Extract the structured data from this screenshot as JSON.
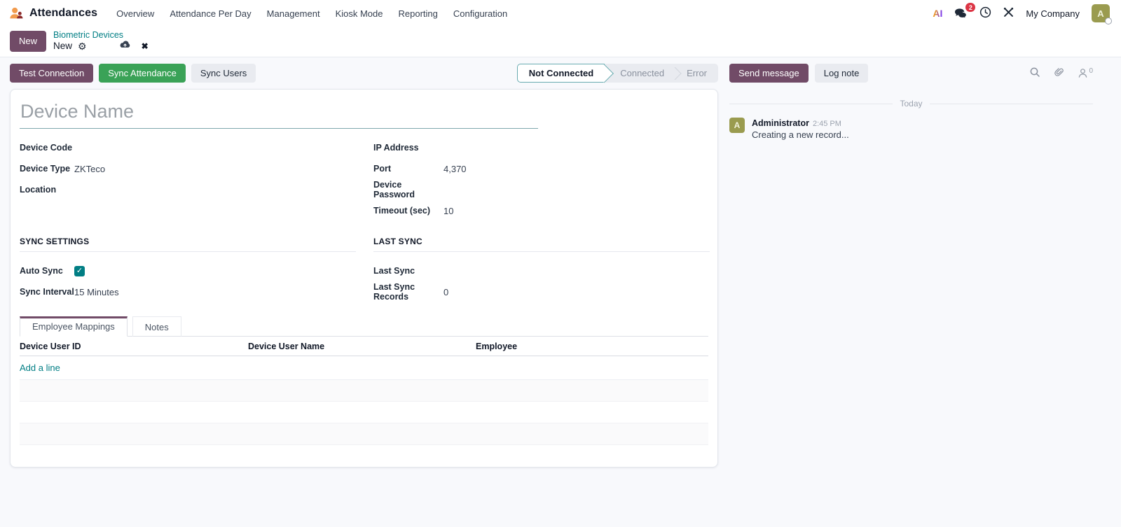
{
  "colors": {
    "primary": "#714B67",
    "accent_teal": "#017E84",
    "success_green": "#3AA257",
    "badge_red": "#DC3545",
    "avatar_olive": "#9A9B4F"
  },
  "icons": {
    "gear": "⚙",
    "discard": "✖",
    "check": "✓"
  },
  "navbar": {
    "app_name": "Attendances",
    "menus": [
      "Overview",
      "Attendance Per Day",
      "Management",
      "Kiosk Mode",
      "Reporting",
      "Configuration"
    ],
    "ai_label": "AI",
    "messages_badge": "2",
    "company": "My Company",
    "avatar_letter": "A"
  },
  "breadcrumb": {
    "new_button": "New",
    "parent": "Biometric Devices",
    "current": "New"
  },
  "actions": {
    "test_connection": "Test Connection",
    "sync_attendance": "Sync Attendance",
    "sync_users": "Sync Users"
  },
  "statusbar": {
    "steps": [
      {
        "label": "Not Connected",
        "active": true
      },
      {
        "label": "Connected",
        "active": false
      },
      {
        "label": "Error",
        "active": false
      }
    ]
  },
  "chatter": {
    "send_message": "Send message",
    "log_note": "Log note",
    "followers_count": "0",
    "date_divider": "Today",
    "messages": [
      {
        "author": "Administrator",
        "time": "2:45 PM",
        "body": "Creating a new record...",
        "avatar_letter": "A"
      }
    ]
  },
  "form": {
    "name_placeholder": "Device Name",
    "fields_left": [
      {
        "label": "Device Code",
        "value": ""
      },
      {
        "label": "Device Type",
        "value": "ZKTeco"
      },
      {
        "label": "Location",
        "value": ""
      }
    ],
    "fields_right": [
      {
        "label": "IP Address",
        "value": ""
      },
      {
        "label": "Port",
        "value": "4,370"
      },
      {
        "label": "Device Password",
        "value": ""
      },
      {
        "label": "Timeout (sec)",
        "value": "10"
      }
    ],
    "sync_settings_title": "SYNC SETTINGS",
    "last_sync_title": "LAST SYNC",
    "auto_sync": {
      "label": "Auto Sync",
      "checked": true
    },
    "sync_interval": {
      "label": "Sync Interval",
      "value": "15 Minutes"
    },
    "last_sync": {
      "label": "Last Sync",
      "value": ""
    },
    "last_sync_records": {
      "label": "Last Sync Records",
      "value": "0"
    },
    "tabs": [
      {
        "label": "Employee Mappings",
        "active": true
      },
      {
        "label": "Notes",
        "active": false
      }
    ],
    "table": {
      "headers": [
        "Device User ID",
        "Device User Name",
        "Employee"
      ],
      "add_line": "Add a line"
    }
  }
}
